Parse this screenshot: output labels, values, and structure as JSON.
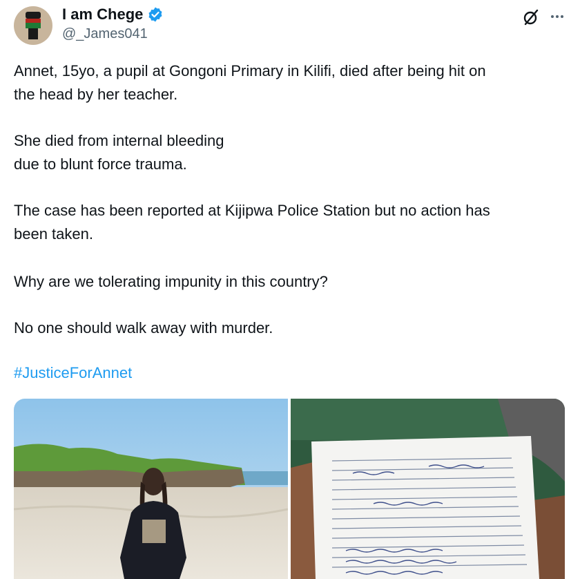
{
  "author": {
    "display_name": "I am Chege",
    "handle": "@_James041",
    "verified": true,
    "avatar_icon": "raised-fist-kenya-flag-icon"
  },
  "header_actions": {
    "grok_icon": "grok-icon",
    "more_icon": "more-options-icon"
  },
  "tweet": {
    "paragraphs": [
      {
        "lines": [
          "Annet, 15yo, a pupil at Gongoni Primary in Kilifi, died after being hit on",
          "the head by her teacher."
        ]
      },
      {
        "lines": [
          "She died from internal bleeding",
          "due to blunt force trauma."
        ]
      },
      {
        "lines": [
          "The case has been reported at Kijipwa Police Station but no action has",
          "been taken."
        ]
      },
      {
        "lines": [
          "Why are we tolerating impunity in this country?"
        ]
      },
      {
        "lines": [
          "No one should walk away with murder."
        ]
      }
    ],
    "hashtag": "#JusticeForAnnet"
  },
  "media": {
    "photos": [
      {
        "description_name": "beach-photo"
      },
      {
        "description_name": "postmortem-form-photo"
      }
    ]
  },
  "colors": {
    "link": "#1d9bf0",
    "verified": "#1d9bf0",
    "text": "#0f1419",
    "secondary": "#536471"
  }
}
